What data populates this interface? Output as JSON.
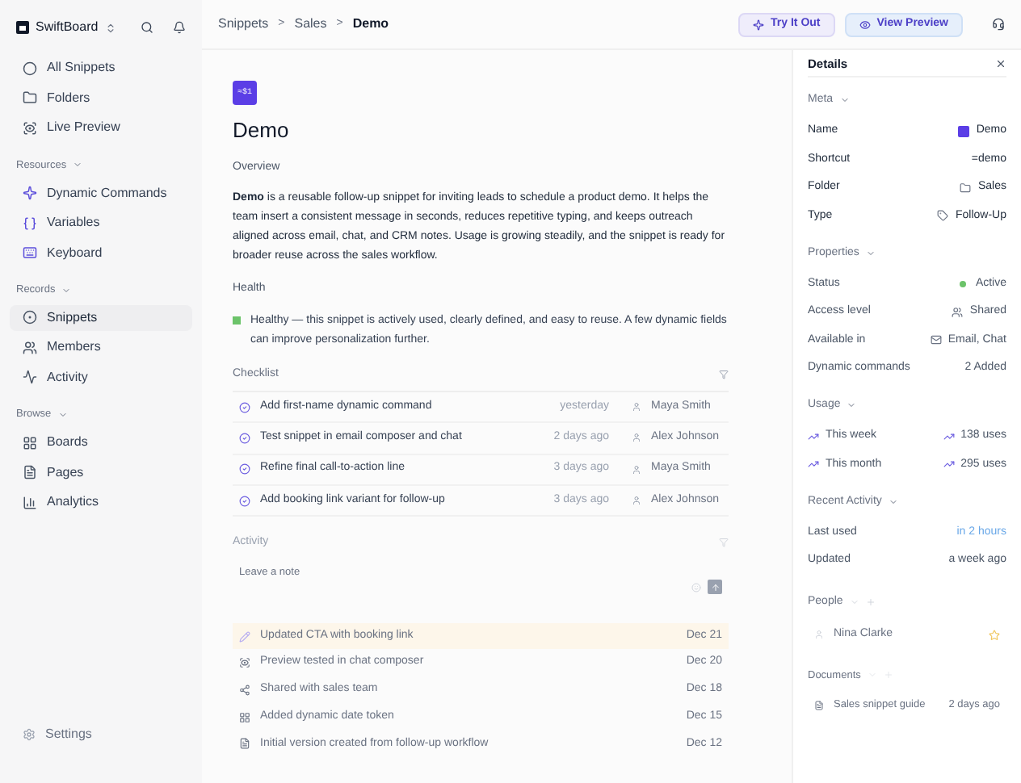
{
  "workspace": {
    "name": "SwiftBoard"
  },
  "sidebar": {
    "top_items": [
      {
        "label": "All Snippets",
        "selected": false
      },
      {
        "label": "Folders",
        "selected": false
      },
      {
        "label": "Live Preview",
        "selected": false
      }
    ],
    "sections": [
      {
        "title": "Resources",
        "items": [
          {
            "label": "Dynamic Commands",
            "selected": false
          },
          {
            "label": "Variables",
            "selected": false
          },
          {
            "label": "Keyboard",
            "selected": false
          }
        ]
      },
      {
        "title": "Records",
        "items": [
          {
            "label": "Snippets",
            "selected": true
          },
          {
            "label": "Members",
            "selected": false
          },
          {
            "label": "Activity",
            "selected": false
          }
        ]
      },
      {
        "title": "Browse",
        "items": [
          {
            "label": "Boards",
            "selected": false
          },
          {
            "label": "Pages",
            "selected": false
          },
          {
            "label": "Analytics",
            "selected": false
          }
        ]
      }
    ],
    "footer": "Settings"
  },
  "breadcrumbs": [
    {
      "label": "Snippets"
    },
    {
      "separator": ">",
      "label": "Sales"
    },
    {
      "separator": ">",
      "label": "Demo"
    }
  ],
  "actions": [
    "Try It Out",
    "View Preview"
  ],
  "page": {
    "badge": "≈$1",
    "title": "Demo",
    "overview_heading": "Overview",
    "overview": "**Demo** is a reusable follow-up snippet for inviting leads to schedule a product demo. It helps the team insert a consistent message in seconds, reduces repetitive typing, and keeps outreach aligned across email, chat, and CRM notes. Usage is growing steadily, and the snippet is ready for broader reuse across the sales workflow.",
    "health_heading": "Health",
    "health": "Healthy — this snippet is actively used, clearly defined, and easy to reuse. A few dynamic fields can improve personalization further.",
    "checklist_heading": "Checklist",
    "checklist": [
      {
        "label": "Add first-name dynamic command",
        "when": "yesterday",
        "person": "Maya Smith",
        "checked": true
      },
      {
        "label": "Test snippet in email composer and chat",
        "when": "2 days ago",
        "person": "Alex Johnson",
        "checked": true
      },
      {
        "label": "Refine final call-to-action line",
        "when": "3 days ago",
        "person": "Maya Smith",
        "checked": true
      },
      {
        "label": "Add booking link variant for follow-up",
        "when": "3 days ago",
        "person": "Alex Johnson",
        "checked": true
      }
    ],
    "activity_heading": "Activity",
    "note": {
      "placeholder": "Leave a note"
    },
    "activity": [
      {
        "label": "Updated CTA with booking link",
        "date": "Dec 21",
        "selected": true
      },
      {
        "label": "Preview tested in chat composer",
        "date": "Dec 20",
        "selected": false
      },
      {
        "label": "Shared with sales team",
        "date": "Dec 18",
        "selected": false
      },
      {
        "label": "Added dynamic date token",
        "date": "Dec 15",
        "selected": false
      },
      {
        "label": "Initial version created from follow-up workflow",
        "date": "Dec 12",
        "selected": false
      }
    ]
  },
  "details": {
    "title": "Details",
    "sections": [
      {
        "title": "Meta",
        "rows": [
          {
            "label": "Name",
            "value": "Demo"
          },
          {
            "label": "Shortcut",
            "value": "=demo"
          },
          {
            "label": "Folder",
            "value": "Sales"
          },
          {
            "label": "Type",
            "value": "Follow-Up"
          }
        ]
      },
      {
        "title": "Properties",
        "rows": [
          {
            "label": "Status",
            "value": "Active"
          },
          {
            "label": "Access level",
            "value": "Shared"
          },
          {
            "label": "Available in",
            "value": "Email, Chat"
          },
          {
            "label": "Dynamic commands",
            "value": "2 Added"
          }
        ]
      },
      {
        "title": "Usage",
        "rows": [
          {
            "label": "This week",
            "value": "138 uses"
          },
          {
            "label": "This month",
            "value": "295 uses"
          }
        ]
      },
      {
        "title": "Recent Activity",
        "rows": [
          {
            "label": "Last used",
            "value": "in 2 hours",
            "kind": "link"
          },
          {
            "label": "Updated",
            "value": "a week ago",
            "kind": "text"
          }
        ]
      }
    ],
    "people_heading": "People",
    "people": [
      {
        "name": "Nina Clarke",
        "starred": true
      }
    ],
    "documents_heading": "Documents",
    "documents": [
      {
        "name": "Sales snippet guide",
        "when": "2 days ago"
      }
    ]
  }
}
